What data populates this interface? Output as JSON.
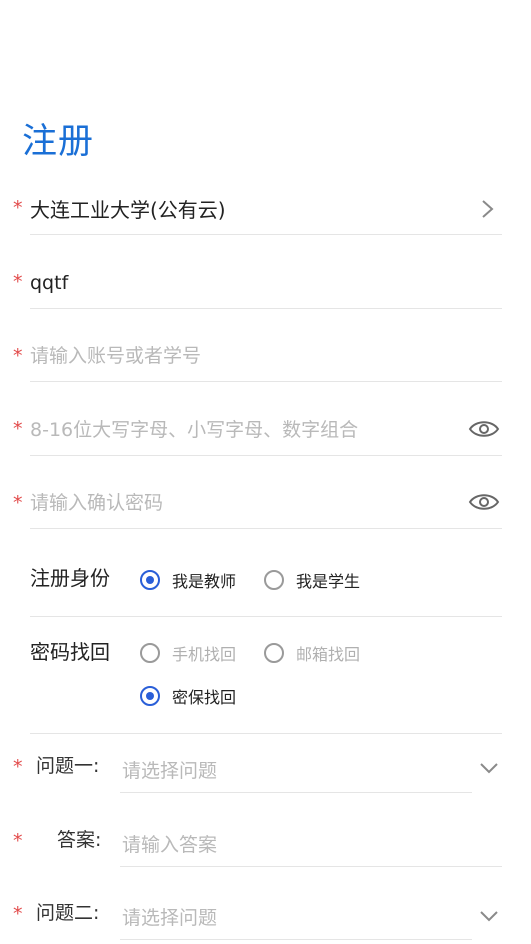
{
  "page_title": "注册",
  "school_field": {
    "value": "大连工业大学(公有云)"
  },
  "name_field": {
    "value": "qqtf"
  },
  "account_field": {
    "value": "",
    "placeholder": "请输入账号或者学号"
  },
  "password_field": {
    "value": "",
    "placeholder": "8-16位大写字母、小写字母、数字组合"
  },
  "confirm_password_field": {
    "value": "",
    "placeholder": "请输入确认密码"
  },
  "identity": {
    "label": "注册身份",
    "options": [
      {
        "label": "我是教师",
        "checked": true
      },
      {
        "label": "我是学生",
        "checked": false
      }
    ]
  },
  "recovery": {
    "label": "密码找回",
    "options": [
      {
        "label": "手机找回",
        "checked": false
      },
      {
        "label": "邮箱找回",
        "checked": false
      },
      {
        "label": "密保找回",
        "checked": true
      }
    ]
  },
  "security": {
    "question1_label": "问题一:",
    "question1_placeholder": "请选择问题",
    "answer1_label": "答案:",
    "answer1_placeholder": "请输入答案",
    "question2_label": "问题二:",
    "question2_placeholder": "请选择问题"
  },
  "icons": {
    "school_chevron": "chevron-right-icon",
    "password_eye": "eye-icon",
    "question_chevron": "chevron-down-icon"
  },
  "colors": {
    "accent": "#1a6fd6",
    "radio_checked": "#2a5fd8",
    "required_star": "#e24a4a",
    "placeholder": "#b9b9b9",
    "divider": "#e5e5e5"
  }
}
